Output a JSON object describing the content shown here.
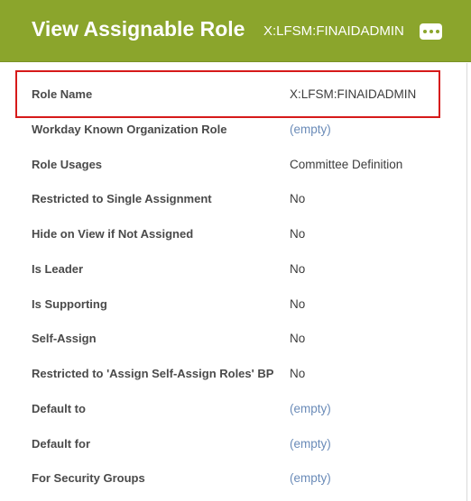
{
  "header": {
    "title": "View Assignable Role",
    "subtitle": "X:LFSM:FINAIDADMIN",
    "more_icon": "more-horizontal-icon"
  },
  "colors": {
    "header_bg": "#8ba52c",
    "highlight": "#d61a1a",
    "empty_value": "#6a8bb8"
  },
  "fields": [
    {
      "label": "Role Name",
      "value": "X:LFSM:FINAIDADMIN"
    },
    {
      "label": "Workday Known Organization Role",
      "value": "(empty)"
    },
    {
      "label": "Role Usages",
      "value": "Committee Definition"
    },
    {
      "label": "Restricted to Single Assignment",
      "value": "No"
    },
    {
      "label": "Hide on View if Not Assigned",
      "value": "No"
    },
    {
      "label": "Is Leader",
      "value": "No"
    },
    {
      "label": "Is Supporting",
      "value": "No"
    },
    {
      "label": "Self-Assign",
      "value": "No"
    },
    {
      "label": "Restricted to 'Assign Self-Assign Roles' BP",
      "value": "No"
    },
    {
      "label": "Default to",
      "value": "(empty)"
    },
    {
      "label": "Default for",
      "value": "(empty)"
    },
    {
      "label": "For Security Groups",
      "value": "(empty)"
    }
  ]
}
